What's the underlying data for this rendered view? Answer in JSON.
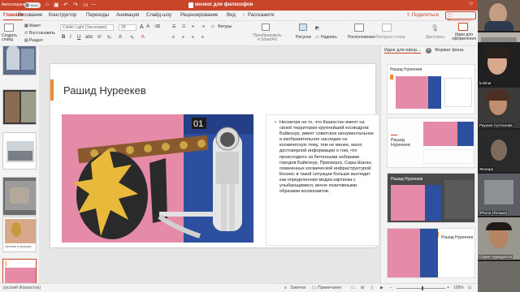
{
  "titlebar": {
    "autosave_label": "Автосохранение",
    "toggle_label": "выкл",
    "document_title": "космос для философов"
  },
  "tabs": [
    {
      "label": "Главная",
      "active": true
    },
    {
      "label": "Вставка",
      "active": false
    },
    {
      "label": "Рисование",
      "active": false
    },
    {
      "label": "Конструктор",
      "active": false
    },
    {
      "label": "Переходы",
      "active": false
    },
    {
      "label": "Анимация",
      "active": false
    },
    {
      "label": "Слайд-шоу",
      "active": false
    },
    {
      "label": "Рецензирование",
      "active": false
    },
    {
      "label": "Вид",
      "active": false
    },
    {
      "label": "Расскажите",
      "active": false
    }
  ],
  "share_label": "Поделиться",
  "comments_label": "Примечания",
  "ribbon": {
    "new_slide": "Создать слайд",
    "layout": "Макет",
    "reset": "Восстановить",
    "section": "Раздел",
    "font_name": "Calibri Light (Заголовки)",
    "font_size": "28",
    "shapes": "Фигуры",
    "convert": "Преобразовать в SmartArt",
    "picture": "Рисунок",
    "textbox": "Надпись",
    "arrange": "Расположение",
    "quick_styles": "Экспресс-стили",
    "design_ideas": "Идеи для оформления",
    "dictate": "Диктовать"
  },
  "slide": {
    "title": "Рашид Нуреекев",
    "bullet": "Несмотря на то, что Казахстан имеет на своей территории крупнейший космодром Байконур, имеет советское монументальное и изобразительное наследие на космическую тему, тем не менее, мало достоверной информации о том, что происходило за бетонными заборами городов Байконур, Приозерск, Сары-Шаган, охваченных космической инфраструктурой. Космос в такой ситуации больше выглядит как определенная медиа картинка с улыбающимися, вечно позитивными образами космонавтов."
  },
  "thumbnails": [
    {
      "number": "",
      "caption": ""
    },
    {
      "number": "",
      "caption": ""
    },
    {
      "number": "",
      "caption": ""
    },
    {
      "number": "",
      "caption": ""
    },
    {
      "number": "",
      "caption": "Цепочка и культура"
    },
    {
      "number": "",
      "caption": ""
    }
  ],
  "design_pane": {
    "tab_ideas": "Идеи для офор...",
    "tab_background": "Формат фона",
    "design_title": "Рашид Нуреекев"
  },
  "statusbar": {
    "language": "русский (Казахстан)",
    "notes": "Заметки",
    "comments": "Примечания",
    "zoom": "108%"
  },
  "participants": [
    {
      "name": ""
    },
    {
      "name": "Казахстан философь"
    },
    {
      "name": "kulshat"
    },
    {
      "name": "Раушан Султанова"
    },
    {
      "name": "Жанара"
    },
    {
      "name": "iPhone (Толкын)"
    },
    {
      "name": "Серик Нурмуратов"
    }
  ],
  "colors": {
    "brand": "#c8452a",
    "accent_bar": "#f08a37",
    "photo_pink": "#e58aa7",
    "photo_blue": "#2d4f9f",
    "bird_yellow": "#e8b93a"
  }
}
